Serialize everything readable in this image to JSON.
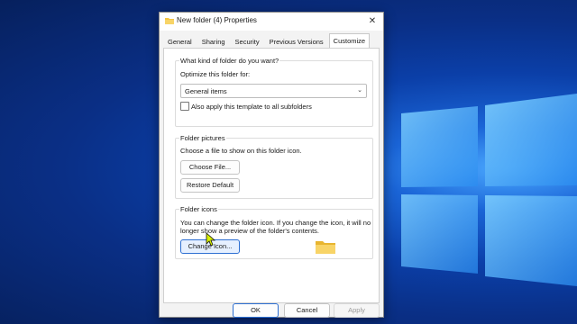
{
  "dialog": {
    "title": "New folder (4) Properties",
    "close_glyph": "✕"
  },
  "tabs": [
    {
      "label": "General",
      "active": false
    },
    {
      "label": "Sharing",
      "active": false
    },
    {
      "label": "Security",
      "active": false
    },
    {
      "label": "Previous Versions",
      "active": false
    },
    {
      "label": "Customize",
      "active": true
    }
  ],
  "folder_type": {
    "group_title": "What kind of folder do you want?",
    "optimize_label": "Optimize this folder for:",
    "selected_value": "General items",
    "subfolders_label": "Also apply this template to all subfolders",
    "subfolders_checked": false
  },
  "folder_pictures": {
    "group_title": "Folder pictures",
    "description": "Choose a file to show on this folder icon.",
    "choose_file_label": "Choose File...",
    "restore_default_label": "Restore Default"
  },
  "folder_icons": {
    "group_title": "Folder icons",
    "description_line1": "You can change the folder icon. If you change the icon, it will no",
    "description_line2": "longer show a preview of the folder's contents.",
    "change_icon_label": "Change Icon..."
  },
  "footer": {
    "ok_label": "OK",
    "cancel_label": "Cancel",
    "apply_label": "Apply"
  },
  "icons": {
    "title_icon": "folder-icon",
    "preview_icon": "folder-icon",
    "pointer": "mouse-cursor"
  },
  "colors": {
    "accent": "#2d6fd2",
    "folder_yellow": "#f4c542",
    "desktop_blue": "#0b3fa8"
  }
}
